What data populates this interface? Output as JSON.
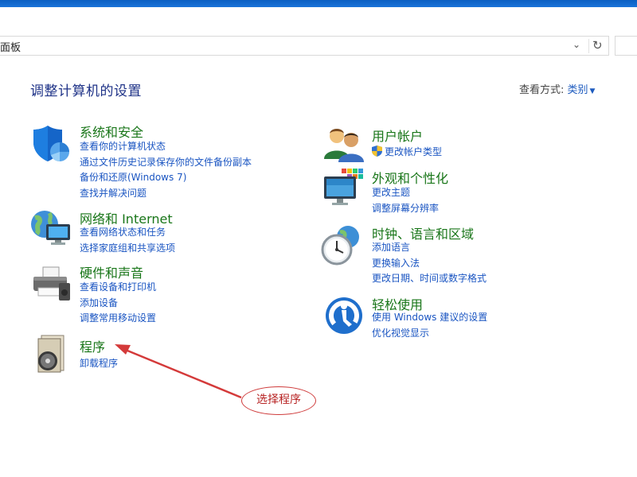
{
  "address": {
    "path_text": "面板",
    "refresh_icon": "refresh-icon"
  },
  "header": {
    "title": "调整计算机的设置",
    "view_by_label": "查看方式:",
    "view_by_value": "类别"
  },
  "left_categories": [
    {
      "title": "系统和安全",
      "icon": "shield-icon",
      "links": [
        "查看你的计算机状态",
        "通过文件历史记录保存你的文件备份副本",
        "备份和还原(Windows 7)",
        "查找并解决问题"
      ]
    },
    {
      "title": "网络和 Internet",
      "icon": "network-globe-icon",
      "links": [
        "查看网络状态和任务",
        "选择家庭组和共享选项"
      ]
    },
    {
      "title": "硬件和声音",
      "icon": "printer-icon",
      "links": [
        "查看设备和打印机",
        "添加设备",
        "调整常用移动设置"
      ]
    },
    {
      "title": "程序",
      "icon": "programs-disc-icon",
      "links": [
        "卸载程序"
      ]
    }
  ],
  "right_categories": [
    {
      "title": "用户帐户",
      "icon": "users-icon",
      "links": [
        "更改帐户类型"
      ]
    },
    {
      "title": "外观和个性化",
      "icon": "monitor-palette-icon",
      "links": [
        "更改主题",
        "调整屏幕分辨率"
      ]
    },
    {
      "title": "时钟、语言和区域",
      "icon": "clock-globe-icon",
      "links": [
        "添加语言",
        "更换输入法",
        "更改日期、时间或数字格式"
      ]
    },
    {
      "title": "轻松使用",
      "icon": "ease-of-access-icon",
      "links": [
        "使用 Windows 建议的设置",
        "优化视觉显示"
      ]
    }
  ],
  "annotation": {
    "text": "选择程序",
    "color": "#cf3b3b"
  },
  "colors": {
    "category_title": "#197619",
    "link": "#1a55c2",
    "page_title": "#1e3287"
  }
}
